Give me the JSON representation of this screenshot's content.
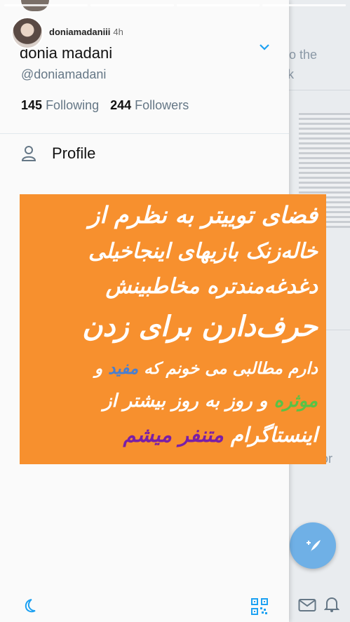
{
  "story": {
    "progress_segments": 4,
    "username": "doniamadaniii",
    "time": "4h"
  },
  "drawer": {
    "display_name": "donia madani",
    "handle": "@doniamadani",
    "following_count": "145",
    "following_label": "Following",
    "followers_count": "244",
    "followers_label": "Followers",
    "menu": [
      {
        "label": "Profile",
        "icon": "person-icon"
      }
    ],
    "bottom_icons": [
      "moon-icon",
      "qr-code-icon"
    ]
  },
  "background": {
    "snippet_1": "o the",
    "snippet_2": "rk",
    "snippet_3": "or",
    "fab_icon": "compose-tweet-icon",
    "nav_icons": [
      "mail-icon",
      "bell-icon"
    ]
  },
  "overlay": {
    "background": "#f7902e",
    "line1": "فضای توییتر به نظرم از",
    "line2": "خاله‌زنک بازیهای اینجاخیلی",
    "line3": "دغدغه‌مندتره  مخاطبینش",
    "line4": "حرف‌دارن برای زدن",
    "line5_a": "دارم مطالبی می خونم که ",
    "line5_b": "مفید",
    "line5_c": " و",
    "line6_a": "موثره",
    "line6_b": " و روز به روز بیشتر از",
    "line7": "اینستاگرام ",
    "line8": "متنفر میشم",
    "colors": {
      "blue": "#4a7fd0",
      "green": "#59c246",
      "purple": "#7a1fa6"
    }
  }
}
